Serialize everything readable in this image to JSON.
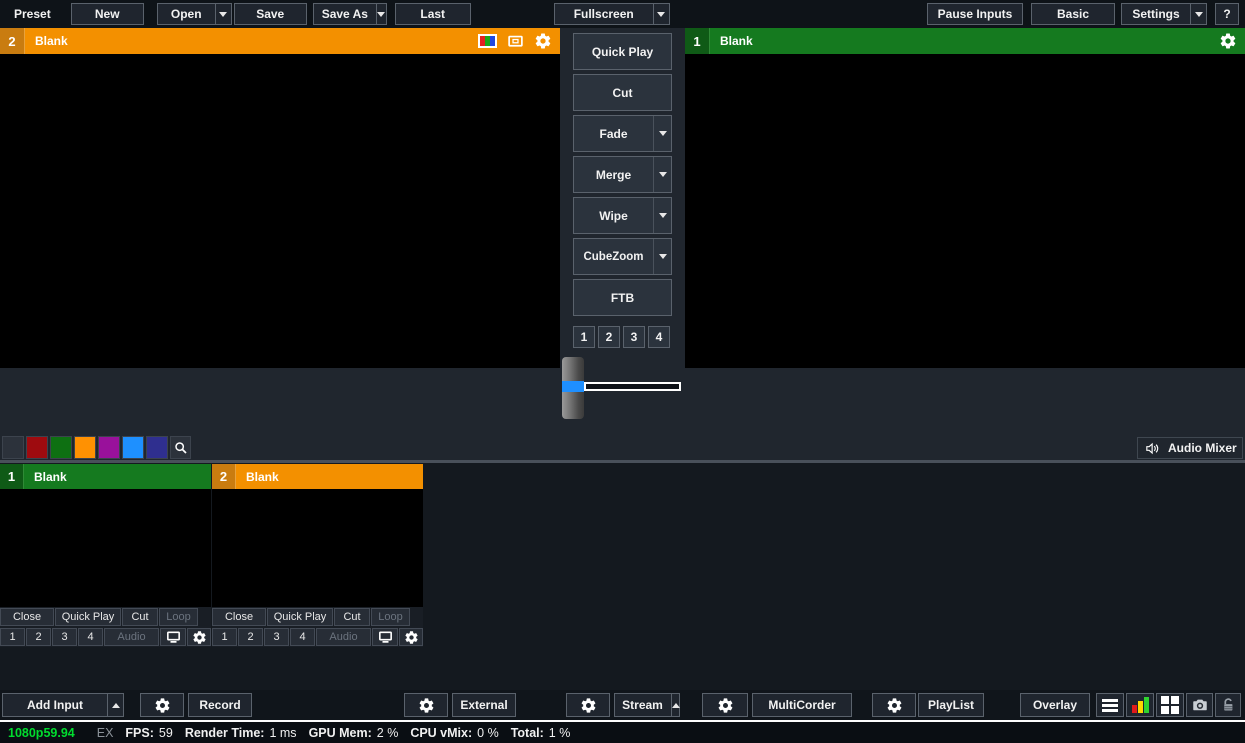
{
  "colors": {
    "preview_orange": "#f39000",
    "program_green": "#157a1f",
    "tbar_blue": "#1e8fff",
    "status_green": "#00dd2e"
  },
  "top_toolbar": {
    "preset_label": "Preset",
    "new": "New",
    "open": "Open",
    "save": "Save",
    "save_as": "Save As",
    "last": "Last",
    "fullscreen": "Fullscreen",
    "pause_inputs": "Pause Inputs",
    "basic": "Basic",
    "settings": "Settings",
    "help": "?"
  },
  "preview_window": {
    "number": "2",
    "title": "Blank"
  },
  "program_window": {
    "number": "1",
    "title": "Blank"
  },
  "transitions": {
    "quick_play": "Quick Play",
    "cut": "Cut",
    "fade": "Fade",
    "merge": "Merge",
    "wipe": "Wipe",
    "cubezoom": "CubeZoom",
    "ftb": "FTB",
    "stingers": [
      "1",
      "2",
      "3",
      "4"
    ]
  },
  "color_bar": {
    "swatches": [
      {
        "name": "none",
        "css": "background:#2c323b"
      },
      {
        "name": "red",
        "css": "background:#9e0b0f"
      },
      {
        "name": "green",
        "css": "background:#0e7012"
      },
      {
        "name": "orange",
        "css": "background:#ff9102"
      },
      {
        "name": "purple",
        "css": "background:#99119b"
      },
      {
        "name": "blue",
        "css": "background:#1e90ff"
      },
      {
        "name": "navy",
        "css": "background:#2f2f8f"
      }
    ],
    "audio_mixer_label": "Audio Mixer"
  },
  "inputs": [
    {
      "number": "1",
      "title": "Blank"
    },
    {
      "number": "2",
      "title": "Blank"
    }
  ],
  "input_controls": {
    "close": "Close",
    "quick_play": "Quick Play",
    "cut": "Cut",
    "loop": "Loop",
    "overlays": [
      "1",
      "2",
      "3",
      "4"
    ],
    "audio": "Audio"
  },
  "bottom_toolbar": {
    "add_input": "Add Input",
    "record": "Record",
    "external": "External",
    "stream": "Stream",
    "multicorder": "MultiCorder",
    "playlist": "PlayList",
    "overlay": "Overlay"
  },
  "status_bar": {
    "resolution": "1080p59.94",
    "ex": "EX",
    "fps_label": "FPS:",
    "fps_value": "59",
    "render_label": "Render Time:",
    "render_value": "1 ms",
    "gpu_label": "GPU Mem:",
    "gpu_value": "2 %",
    "cpu_label": "CPU vMix:",
    "cpu_value": "0 %",
    "total_label": "Total:",
    "total_value": "1 %"
  }
}
